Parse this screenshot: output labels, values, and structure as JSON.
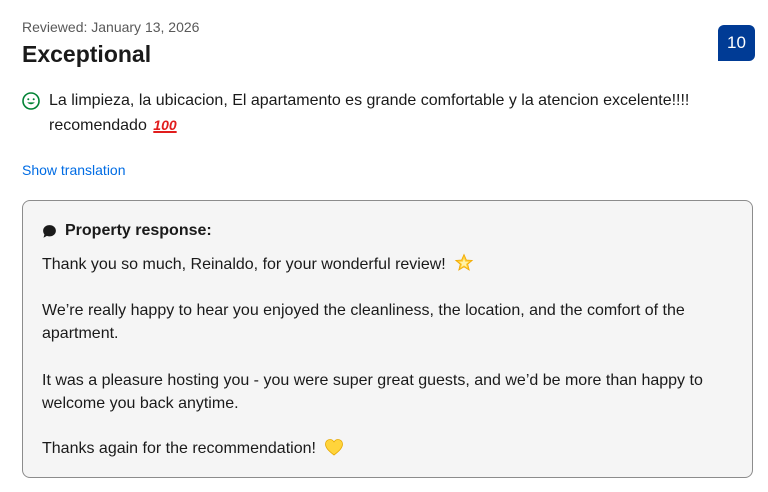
{
  "review": {
    "date_text": "Reviewed: January 13, 2026",
    "title": "Exceptional",
    "score": "10",
    "positive_text_line1": "La limpieza, la ubicacion, El apartamento es grande comfortable y la atencion excelente!!!!",
    "positive_text_line2": "recomendado",
    "hundred_emoji": "100",
    "show_translation_label": "Show translation"
  },
  "response": {
    "heading": "Property response:",
    "paragraphs": [
      "Thank you so much, Reinaldo, for your wonderful review!",
      "We’re really happy to hear you enjoyed the cleanliness, the location, and the comfort of the apartment.",
      "It was a pleasure hosting you - you were super great guests, and we’d be more than happy to welcome you back anytime.",
      "Thanks again for the recommendation!"
    ]
  },
  "icons": {
    "positive": "smiley-face-icon",
    "response": "chat-bubble-icon",
    "star": "glowing-star-emoji",
    "heart": "yellow-heart-emoji"
  },
  "colors": {
    "score_badge": "#003b95",
    "link": "#006ce4",
    "positive_icon": "#008234",
    "response_bg": "#f5f5f5",
    "response_border": "#8c8c8c"
  }
}
